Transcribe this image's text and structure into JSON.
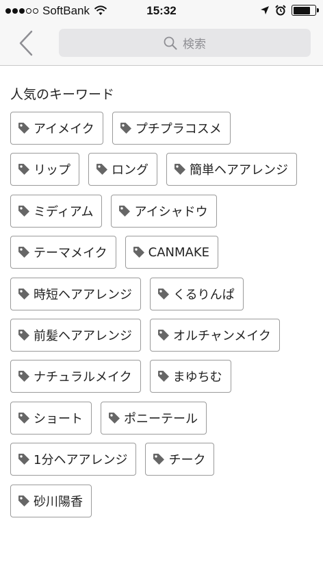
{
  "status_bar": {
    "carrier": "SoftBank",
    "time": "15:32"
  },
  "nav": {
    "search_placeholder": "検索"
  },
  "section": {
    "title": "人気のキーワード"
  },
  "tag_rows": [
    [
      "アイメイク",
      "プチプラコスメ"
    ],
    [
      "リップ",
      "ロング",
      "簡単ヘアアレンジ"
    ],
    [
      "ミディアム",
      "アイシャドウ"
    ],
    [
      "テーマメイク",
      "CANMAKE"
    ],
    [
      "時短ヘアアレンジ",
      "くるりんぱ"
    ],
    [
      "前髪ヘアアレンジ",
      "オルチャンメイク"
    ],
    [
      "ナチュラルメイク",
      "まゆちむ"
    ],
    [
      "ショート",
      "ポニーテール"
    ],
    [
      "1分ヘアアレンジ",
      "チーク"
    ],
    [
      "砂川陽香"
    ]
  ],
  "colors": {
    "accent_gray": "#8e8e93",
    "tag_icon": "#666666",
    "tag_border": "#9a9a9a"
  }
}
